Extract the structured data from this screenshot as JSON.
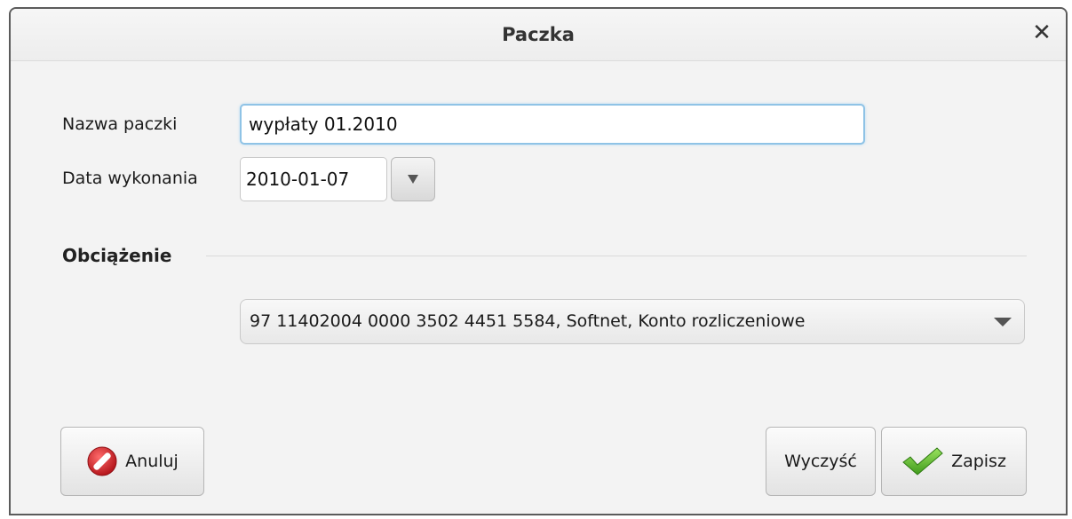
{
  "window": {
    "title": "Paczka",
    "close_label": "✕"
  },
  "form": {
    "name_label": "Nazwa paczki",
    "name_value": "wypłaty 01.2010",
    "date_label": "Data wykonania",
    "date_value": "2010-01-07",
    "date_dropdown_icon": "triangle-down-icon"
  },
  "section": {
    "title": "Obciążenie",
    "account_selected": "97 11402004 0000 3502 4451 5584, Softnet, Konto rozliczeniowe"
  },
  "buttons": {
    "cancel_label": "Anuluj",
    "cancel_icon": "no-entry-icon",
    "clear_label": "Wyczyść",
    "save_label": "Zapisz",
    "save_icon": "checkmark-icon"
  },
  "colors": {
    "focus_border": "#8fc3e6",
    "cancel_icon_red": "#d9262c",
    "save_icon_green": "#5cb82a"
  }
}
